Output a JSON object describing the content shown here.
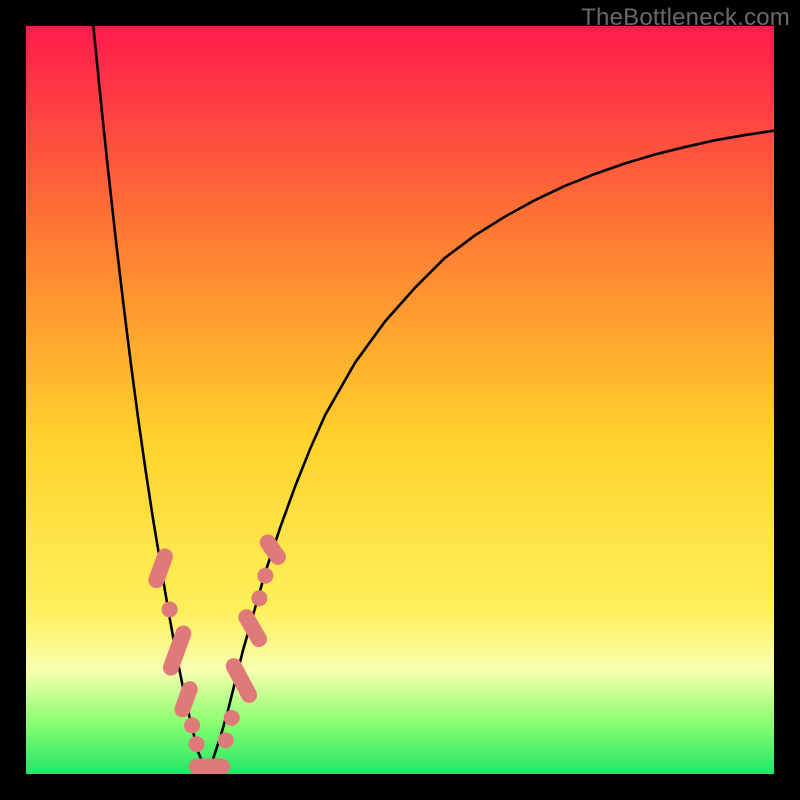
{
  "watermark": "TheBottleneck.com",
  "colors": {
    "grad_top": "#ff1a4d",
    "grad_upper_mid": "#ff7a33",
    "grad_mid": "#ffd22b",
    "grad_lower_mid": "#fff05a",
    "grad_lowband_pale": "#f9ffb0",
    "grad_green_light": "#8bff70",
    "grad_green": "#23e567",
    "line": "#000000",
    "marker_fill": "#e07a7a",
    "marker_stroke": "#cc6f6f",
    "frame_bg": "#000000"
  },
  "chart_data": {
    "type": "line",
    "title": "",
    "xlabel": "",
    "ylabel": "",
    "xlim": [
      0,
      100
    ],
    "ylim": [
      0,
      100
    ],
    "x_min_at": 24,
    "series": [
      {
        "name": "left-branch",
        "x": [
          9,
          10,
          11,
          12,
          13,
          14,
          15,
          16,
          17,
          18,
          19,
          20,
          21,
          22,
          23,
          24
        ],
        "y": [
          100,
          90,
          80.5,
          71.5,
          63,
          55,
          47.5,
          40.5,
          34,
          28,
          22,
          16.5,
          11.5,
          7,
          3,
          0.5
        ]
      },
      {
        "name": "right-branch",
        "x": [
          24,
          25,
          26,
          27,
          28,
          29,
          30,
          32,
          34,
          36,
          38,
          40,
          44,
          48,
          52,
          56,
          60,
          64,
          68,
          72,
          76,
          80,
          84,
          88,
          92,
          96,
          100
        ],
        "y": [
          0.5,
          2,
          5,
          8.5,
          12.5,
          16.5,
          20,
          27,
          33,
          38.5,
          43.5,
          48,
          55,
          60.5,
          65,
          69,
          72,
          74.5,
          76.7,
          78.6,
          80.2,
          81.6,
          82.8,
          83.8,
          84.7,
          85.4,
          86
        ]
      }
    ],
    "markers": [
      {
        "shape": "pill",
        "cx": 18.0,
        "cy": 27.5,
        "angle": -70,
        "len": 5.5
      },
      {
        "shape": "dot",
        "cx": 19.2,
        "cy": 22.0
      },
      {
        "shape": "pill",
        "cx": 20.2,
        "cy": 16.5,
        "angle": -70,
        "len": 7.0
      },
      {
        "shape": "pill",
        "cx": 21.4,
        "cy": 10.0,
        "angle": -70,
        "len": 5.0
      },
      {
        "shape": "dot",
        "cx": 22.2,
        "cy": 6.5
      },
      {
        "shape": "dot",
        "cx": 22.8,
        "cy": 4.0
      },
      {
        "shape": "pill",
        "cx": 24.5,
        "cy": 1.0,
        "angle": 0,
        "len": 5.5
      },
      {
        "shape": "dot",
        "cx": 26.7,
        "cy": 4.5
      },
      {
        "shape": "dot",
        "cx": 27.5,
        "cy": 7.5
      },
      {
        "shape": "pill",
        "cx": 28.8,
        "cy": 12.5,
        "angle": 62,
        "len": 6.5
      },
      {
        "shape": "pill",
        "cx": 30.3,
        "cy": 19.5,
        "angle": 60,
        "len": 5.5
      },
      {
        "shape": "dot",
        "cx": 31.2,
        "cy": 23.5
      },
      {
        "shape": "dot",
        "cx": 32.0,
        "cy": 26.5
      },
      {
        "shape": "pill",
        "cx": 33.0,
        "cy": 30.0,
        "angle": 55,
        "len": 4.5
      }
    ]
  }
}
